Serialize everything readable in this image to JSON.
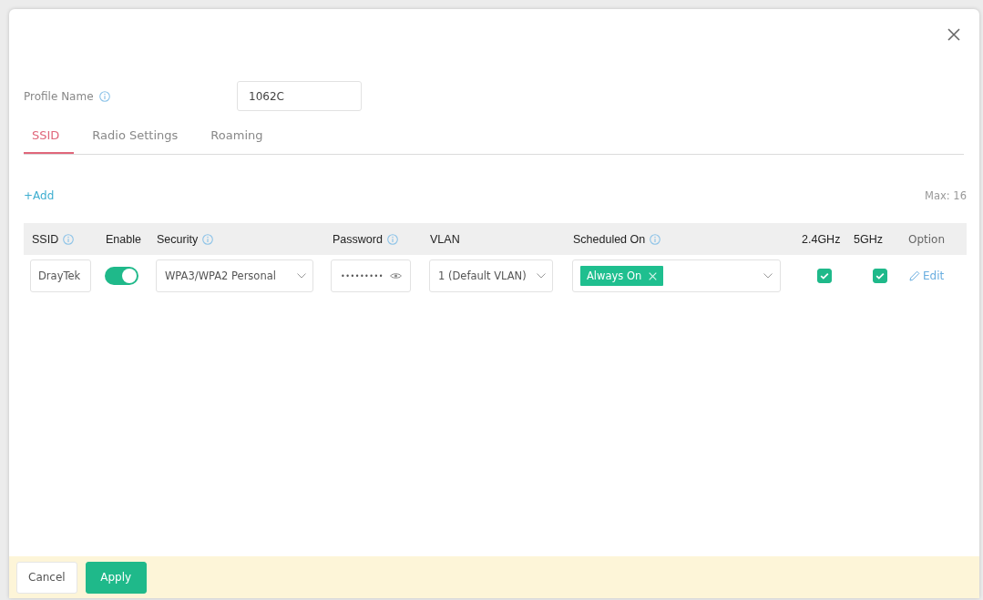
{
  "profile_name": {
    "label": "Profile Name",
    "info": true,
    "value": "1062C"
  },
  "tabs": [
    {
      "label": "SSID",
      "selected": true
    },
    {
      "label": "Radio Settings",
      "selected": false
    },
    {
      "label": "Roaming",
      "selected": false
    }
  ],
  "add_link": "+Add",
  "max_label": "Max: 16",
  "table": {
    "columns": [
      {
        "label": "SSID",
        "info": true
      },
      {
        "label": "Enable",
        "info": false
      },
      {
        "label": "Security",
        "info": true
      },
      {
        "label": "Password",
        "info": true
      },
      {
        "label": "VLAN",
        "info": false
      },
      {
        "label": "Scheduled On",
        "info": true
      },
      {
        "label": "2.4GHz",
        "info": false
      },
      {
        "label": "5GHz",
        "info": false
      },
      {
        "label": "Option",
        "info": false
      }
    ],
    "rows": [
      {
        "ssid": "DrayTek",
        "enabled": true,
        "security": "WPA3/WPA2 Personal",
        "password": "•••••••••",
        "vlan": "1 (Default VLAN)",
        "schedule_tags": [
          "Always On"
        ],
        "band_24": true,
        "band_5": true,
        "option": "Edit"
      }
    ]
  },
  "footer": {
    "buttons": [
      {
        "label": "Cancel",
        "kind": "secondary"
      },
      {
        "label": "Apply",
        "kind": "primary"
      }
    ]
  }
}
